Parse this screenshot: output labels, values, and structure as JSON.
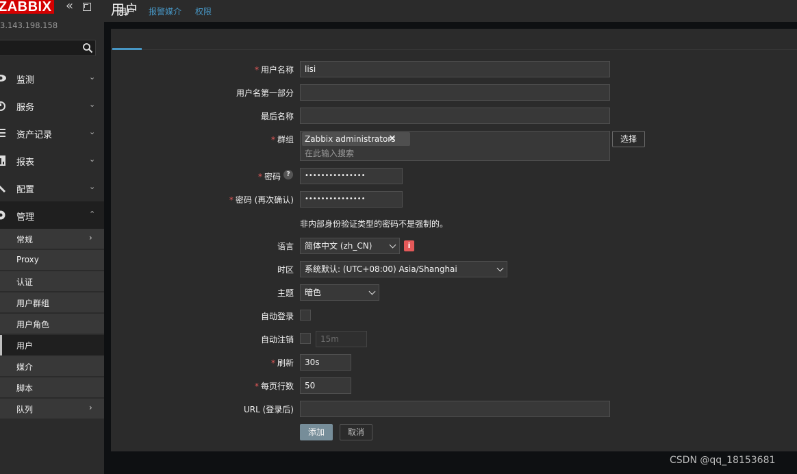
{
  "app": {
    "logo_text": "ZABBIX",
    "server_ip": "3.143.198.158"
  },
  "sidebar": {
    "menu": [
      {
        "label": "监测",
        "icon": "eye-icon"
      },
      {
        "label": "服务",
        "icon": "clock-icon"
      },
      {
        "label": "资产记录",
        "icon": "list-icon"
      },
      {
        "label": "报表",
        "icon": "bar-chart-icon"
      },
      {
        "label": "配置",
        "icon": "wrench-icon"
      },
      {
        "label": "管理",
        "icon": "gear-icon"
      }
    ],
    "submenu": [
      {
        "label": "常规",
        "has_arrow": true
      },
      {
        "label": "Proxy"
      },
      {
        "label": "认证"
      },
      {
        "label": "用户群组"
      },
      {
        "label": "用户角色"
      },
      {
        "label": "用户",
        "selected": true
      },
      {
        "label": "媒介"
      },
      {
        "label": "脚本"
      },
      {
        "label": "队列",
        "has_arrow": true
      }
    ]
  },
  "header": {
    "title": "用户"
  },
  "tabs": [
    {
      "label": "用户",
      "active": true
    },
    {
      "label": "报警媒介"
    },
    {
      "label": "权限"
    }
  ],
  "form": {
    "username": {
      "label": "用户名称",
      "value": "lisi"
    },
    "firstname": {
      "label": "用户名第一部分",
      "value": ""
    },
    "lastname": {
      "label": "最后名称",
      "value": ""
    },
    "groups": {
      "label": "群组",
      "tag": "Zabbix administrators",
      "placeholder": "在此输入搜索",
      "select_button": "选择"
    },
    "password": {
      "label": "密码",
      "value": "•••••••••••••••"
    },
    "password_confirm": {
      "label": "密码 (再次确认)",
      "value": "•••••••••••••••"
    },
    "password_note": "非内部身份验证类型的密码不是强制的。",
    "language": {
      "label": "语言",
      "value": "简体中文 (zh_CN)"
    },
    "timezone": {
      "label": "时区",
      "value": "系统默认: (UTC+08:00) Asia/Shanghai"
    },
    "theme": {
      "label": "主题",
      "value": "暗色"
    },
    "autologin": {
      "label": "自动登录"
    },
    "autologout": {
      "label": "自动注销",
      "value": "15m"
    },
    "refresh": {
      "label": "刷新",
      "value": "30s"
    },
    "rows_per_page": {
      "label": "每页行数",
      "value": "50"
    },
    "url": {
      "label": "URL (登录后)",
      "value": ""
    },
    "add_button": "添加",
    "cancel_button": "取消"
  },
  "watermark": "CSDN @qq_18153681",
  "colors": {
    "accent": "#4796c4",
    "required": "#e45959",
    "logo": "#d40000",
    "primary_button": "#768d99"
  }
}
